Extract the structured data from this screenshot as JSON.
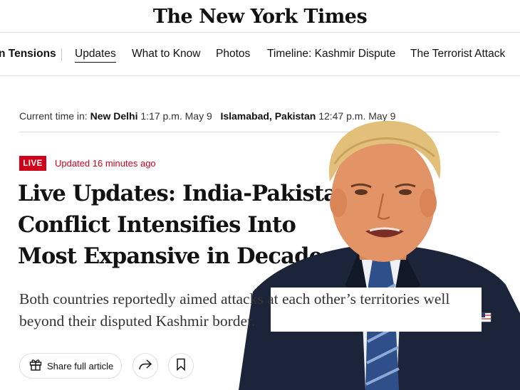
{
  "masthead": {
    "logo_text": "The New York Times"
  },
  "nav": {
    "items": [
      {
        "label": "n Tensions"
      },
      {
        "label": "Updates"
      },
      {
        "label": "What to Know"
      },
      {
        "label": "Photos"
      },
      {
        "label": "Timeline: Kashmir Dispute"
      },
      {
        "label": "The Terrorist Attack"
      }
    ]
  },
  "timebar": {
    "prefix": "Current time in:",
    "city1": "New Delhi",
    "time1": "1:17 p.m. May 9",
    "city2": "Islamabad, Pakistan",
    "time2": "12:47 p.m. May 9"
  },
  "article": {
    "live_badge": "LIVE",
    "updated": "Updated 16 minutes ago",
    "headline": "Live Updates: India-Pakistan Conflict Intensifies Into Most Expansive in Decades",
    "summary": "Both countries reportedly aimed attacks at each other’s territories well beyond their disputed Kashmir border."
  },
  "actions": {
    "share_label": "Share full article",
    "icons": {
      "share": "gift-icon",
      "forward": "forward-arrow-icon",
      "save": "bookmark-icon"
    }
  },
  "colors": {
    "accent": "#d0021b",
    "text": "#121212"
  }
}
